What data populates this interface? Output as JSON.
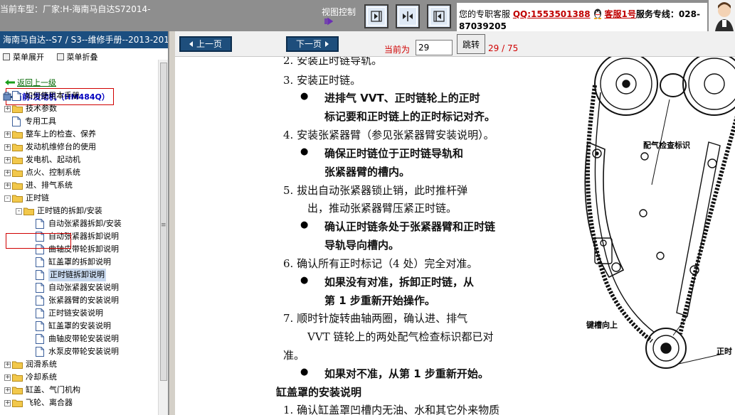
{
  "header": {
    "vehicle_info": "当前车型：厂家:H-海南马自达S72014-",
    "view_control_label": "视图控制",
    "view_buttons": [
      "layout-left",
      "layout-split",
      "layout-right"
    ],
    "contact_prefix": "您的专职客服",
    "contact_qq": "QQ:1553501388",
    "contact_kf": "客服1号",
    "contact_tel_label": "服务专线：028-",
    "contact_tel_cont": "87039205"
  },
  "left_panel": {
    "manual_title": "海南马自达--S7 / S3--维修手册--2013-2014",
    "expand_all": "菜单展开",
    "collapse_all": "菜单折叠",
    "back_link": "返回上一级",
    "current_label": "当前:发动机（HM484Q）",
    "tree": [
      {
        "label": "如何使用本手册",
        "kind": "doc",
        "level": 0,
        "exp": ""
      },
      {
        "label": "技术参数",
        "kind": "folder",
        "level": 0,
        "exp": "+"
      },
      {
        "label": "专用工具",
        "kind": "doc",
        "level": 0,
        "exp": ""
      },
      {
        "label": "整车上的检查、保养",
        "kind": "folder",
        "level": 0,
        "exp": "+"
      },
      {
        "label": "发动机维修台的使用",
        "kind": "folder",
        "level": 0,
        "exp": "+"
      },
      {
        "label": "发电机、起动机",
        "kind": "folder",
        "level": 0,
        "exp": "+"
      },
      {
        "label": "点火、控制系统",
        "kind": "folder",
        "level": 0,
        "exp": "+"
      },
      {
        "label": "进、排气系统",
        "kind": "folder",
        "level": 0,
        "exp": "+"
      },
      {
        "label": "正时链",
        "kind": "folder",
        "level": 0,
        "exp": "-"
      },
      {
        "label": "正时链的拆卸/安装",
        "kind": "folder",
        "level": 1,
        "exp": "-"
      },
      {
        "label": "自动张紧器拆卸/安装",
        "kind": "doc",
        "level": 2,
        "exp": ""
      },
      {
        "label": "自动张紧器拆卸说明",
        "kind": "doc",
        "level": 2,
        "exp": ""
      },
      {
        "label": "曲轴皮带轮拆卸说明",
        "kind": "doc",
        "level": 2,
        "exp": ""
      },
      {
        "label": "缸盖罩的拆卸说明",
        "kind": "doc",
        "level": 2,
        "exp": ""
      },
      {
        "label": "正时链拆卸说明",
        "kind": "doc",
        "level": 2,
        "exp": "",
        "selected": true
      },
      {
        "label": "自动张紧器安装说明",
        "kind": "doc",
        "level": 2,
        "exp": ""
      },
      {
        "label": "张紧器臂的安装说明",
        "kind": "doc",
        "level": 2,
        "exp": ""
      },
      {
        "label": "正时链安装说明",
        "kind": "doc",
        "level": 2,
        "exp": ""
      },
      {
        "label": "缸盖罩的安装说明",
        "kind": "doc",
        "level": 2,
        "exp": ""
      },
      {
        "label": "曲轴皮带轮安装说明",
        "kind": "doc",
        "level": 2,
        "exp": ""
      },
      {
        "label": "水泵皮带轮安装说明",
        "kind": "doc",
        "level": 2,
        "exp": ""
      },
      {
        "label": "润滑系统",
        "kind": "folder",
        "level": 0,
        "exp": "+"
      },
      {
        "label": "冷却系统",
        "kind": "folder",
        "level": 0,
        "exp": "+"
      },
      {
        "label": "缸盖、气门机构",
        "kind": "folder",
        "level": 0,
        "exp": "+"
      },
      {
        "label": "飞轮、离合器",
        "kind": "folder",
        "level": 0,
        "exp": "+"
      }
    ]
  },
  "nav": {
    "prev_label": "上一页",
    "next_label": "下一页",
    "current_page_label": "当前为",
    "current_page_value": "29",
    "jump_label": "跳转",
    "page_info": "29 / 75"
  },
  "document": {
    "lines": [
      "2.   安装正时链导轨。",
      "3.   安装正时链。",
      "进排气 VVT、正时链轮上的正时",
      "标记要和正时链上的正时标记对齐。",
      "4.   安装张紧器臂（参见张紧器臂安装说明）。",
      "确保正时链位于正时链导轨和",
      "张紧器臂的槽内。",
      "5.   拔出自动张紧器锁止销，此时推杆弹",
      "出，推动张紧器臂压紧正时链。",
      "确认正时链条处于张紧器臂和正时链",
      "导轨导向槽内。",
      "6.   确认所有正时标记（4 处）完全对准。",
      "如果没有对准，拆卸正时链，从",
      "第 1 步重新开始操作。",
      "7.   顺时针旋转曲轴两圈，确认进、排气",
      "VVT  链轮上的两处配气检查标识都已对",
      "准。",
      "如果对不准，从第 1 步重新开始。",
      "缸盖罩的安装说明",
      "1.   确认缸盖罩凹槽内无油、水和其它外来物质"
    ],
    "diagram_labels": {
      "check_mark": "配气检查标识",
      "key_up": "键槽向上",
      "timing": "正时"
    }
  }
}
